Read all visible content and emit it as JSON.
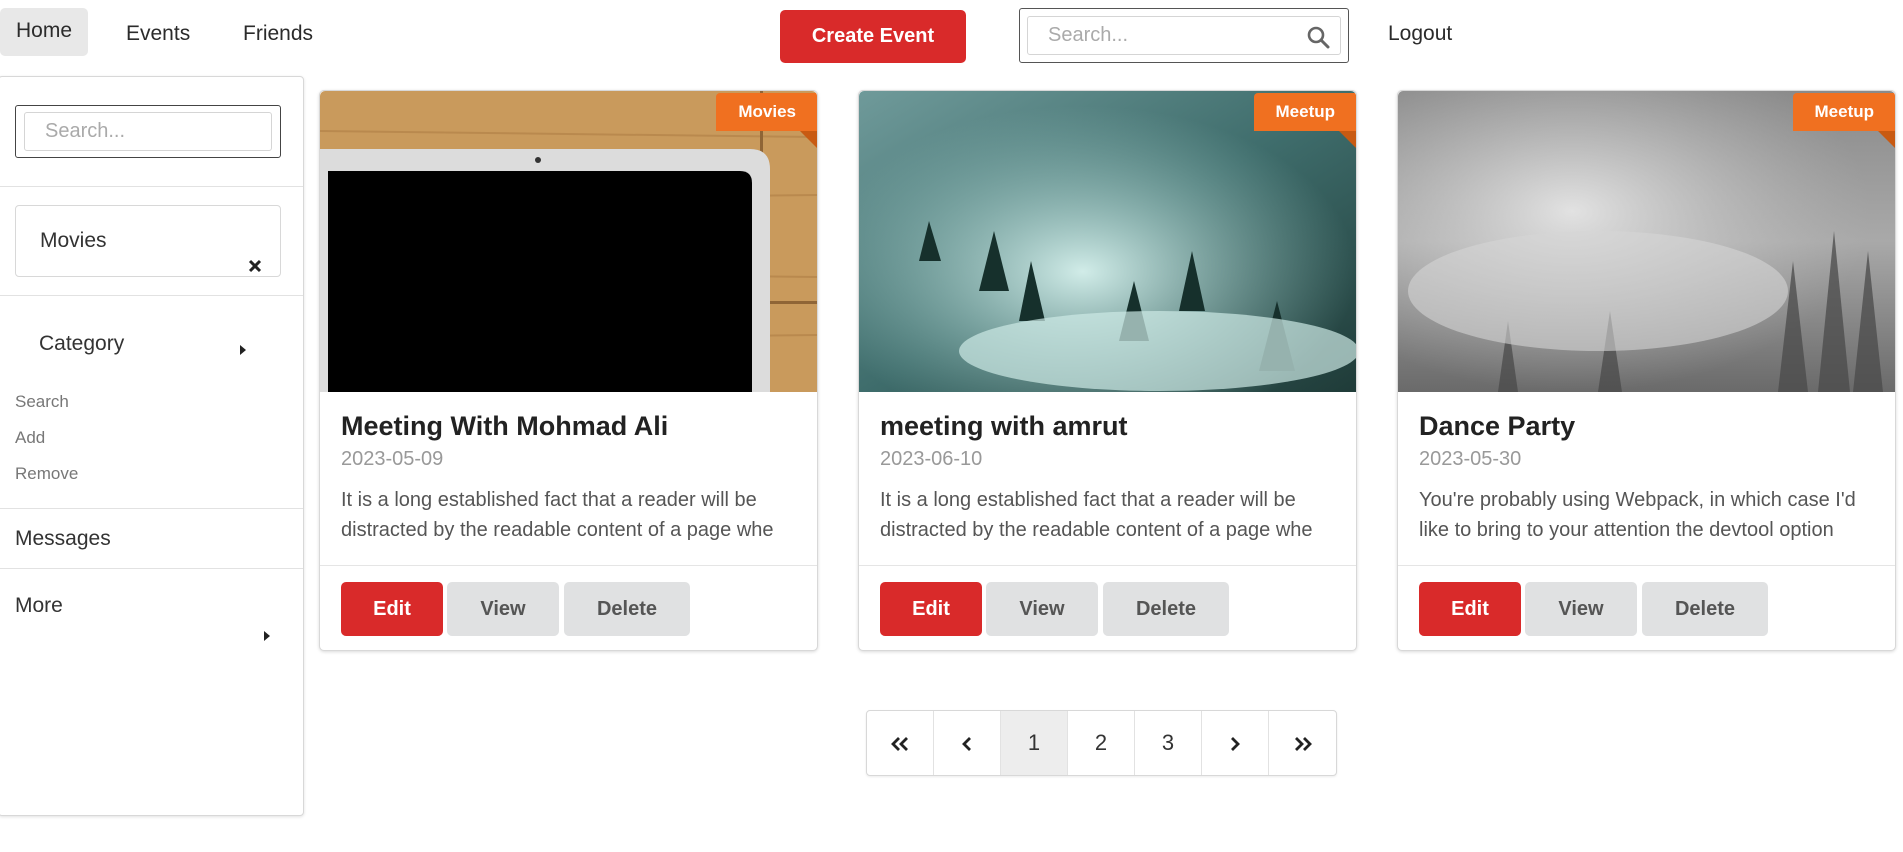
{
  "nav": {
    "home": "Home",
    "events": "Events",
    "friends": "Friends",
    "create_event": "Create Event",
    "search_placeholder": "Search...",
    "logout": "Logout"
  },
  "sidebar": {
    "search_placeholder": "Search...",
    "filter_chip": "Movies",
    "category": "Category",
    "links": [
      "Search",
      "Add",
      "Remove"
    ],
    "messages": "Messages",
    "more": "More"
  },
  "cards": [
    {
      "tag": "Movies",
      "title": "Meeting With Mohmad Ali",
      "date": "2023-05-09",
      "description": "It is a long established fact that a reader will be distracted by the readable content of a page whe",
      "image": "laptop on wooden table"
    },
    {
      "tag": "Meetup",
      "title": "meeting with amrut",
      "date": "2023-06-10",
      "description": "It is a long established fact that a reader will be distracted by the readable content of a page whe",
      "image": "misty forest hillside"
    },
    {
      "tag": "Meetup",
      "title": "Dance Party",
      "date": "2023-05-30",
      "description": "You're probably using Webpack, in which case I'd like to bring to your attention the devtool option",
      "image": "foggy grayscale forest"
    }
  ],
  "card_buttons": {
    "edit": "Edit",
    "view": "View",
    "delete": "Delete"
  },
  "pagination": {
    "pages": [
      "1",
      "2",
      "3"
    ],
    "current": "1"
  },
  "colors": {
    "primary_red": "#d92a2a",
    "ribbon_orange": "#f07020",
    "button_grey": "#e0e1e2"
  }
}
